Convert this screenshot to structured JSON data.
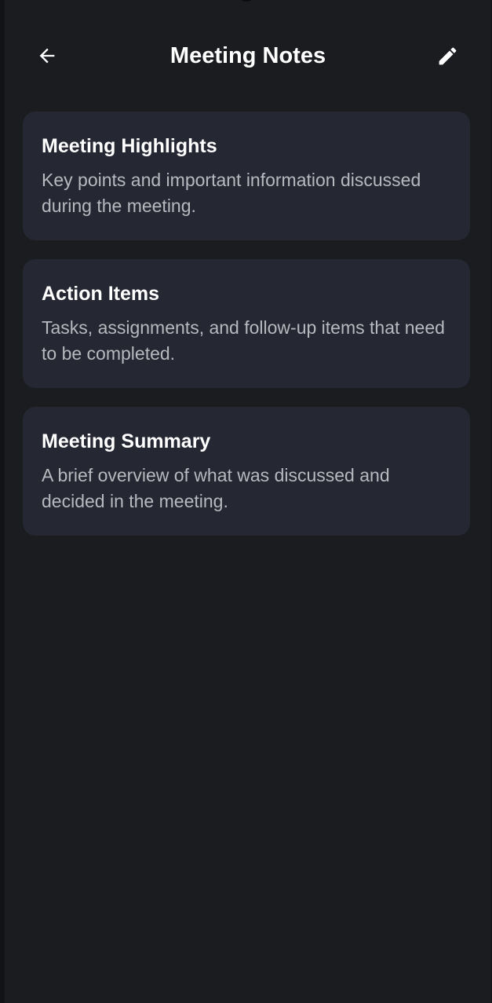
{
  "app_bar": {
    "title": "Meeting Notes",
    "back_icon": "arrow-back-icon",
    "edit_icon": "pencil-edit-icon"
  },
  "cards": [
    {
      "title": "Meeting Highlights",
      "description": "Key points and important information discussed during the meeting."
    },
    {
      "title": "Action Items",
      "description": "Tasks, assignments, and follow-up items that need to be completed."
    },
    {
      "title": "Meeting Summary",
      "description": "A brief overview of what was discussed and decided in the meeting."
    }
  ],
  "colors": {
    "background": "#1b1c20",
    "card": "#252733",
    "title_text": "#ffffff",
    "body_text": "#b8b9bf"
  }
}
